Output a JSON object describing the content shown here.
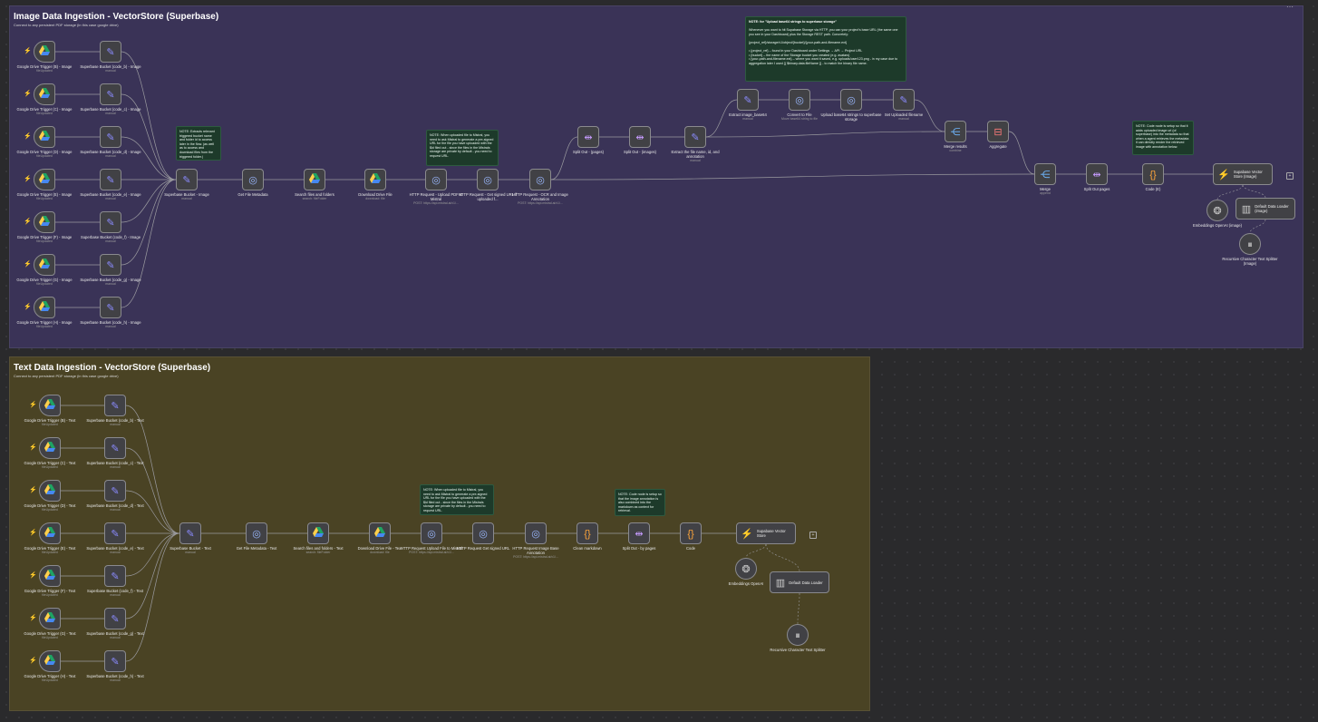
{
  "image_group": {
    "title": "Image Data Ingestion - VectorStore (Superbase)",
    "subtitle": "Connect to any persistent PDF storage (in this case google drive)",
    "triggers": [
      {
        "label": "Google Drive Trigger (B) - Image",
        "sub": "fileUpdated"
      },
      {
        "label": "Google Drive Trigger (C) - Image",
        "sub": "fileUpdated"
      },
      {
        "label": "Google Drive Trigger (D) - Image",
        "sub": "fileUpdated"
      },
      {
        "label": "Google Drive Trigger (E) - Image",
        "sub": "fileUpdated"
      },
      {
        "label": "Google Drive Trigger (F) - Image",
        "sub": "fileUpdated"
      },
      {
        "label": "Google Drive Trigger (G) - Image",
        "sub": "fileUpdated"
      },
      {
        "label": "Google Drive Trigger (H) - Image",
        "sub": "fileUpdated"
      }
    ],
    "buckets": [
      {
        "label": "Superbase Bucket (code_b) - Image",
        "sub": "manual"
      },
      {
        "label": "Superbase Bucket (code_c) - Image",
        "sub": "manual"
      },
      {
        "label": "Superbase Bucket (code_d) - Image",
        "sub": "manual"
      },
      {
        "label": "Superbase Bucket (code_e) - Image",
        "sub": "manual"
      },
      {
        "label": "Superbase Bucket (code_f) - Image",
        "sub": "manual"
      },
      {
        "label": "Superbase Bucket (code_g) - Image",
        "sub": "manual"
      },
      {
        "label": "Superbase Bucket (code_h) - Image",
        "sub": "manual"
      }
    ],
    "pipeline": [
      {
        "label": "Superbase Bucket - Image",
        "sub": "manual"
      },
      {
        "label": "Get File Metadata",
        "sub": ""
      },
      {
        "label": "Search files and folders",
        "sub": "search: fileFolder"
      },
      {
        "label": "Download Drive File",
        "sub": "download: file"
      },
      {
        "label": "HTTP Request - Upload PDF to Mistral",
        "sub": "POST: https://api.mistral.ai/v1/..."
      },
      {
        "label": "HTTP Request - Get signed URL if uploaded f...",
        "sub": ""
      },
      {
        "label": "HTTP Request - OCR and Image Annotation",
        "sub": "POST: https://api.mistral.ai/v1/..."
      }
    ],
    "split_pages": {
      "label": "Split Out - (pages)",
      "sub": ""
    },
    "split_images": {
      "label": "Split Out - (images)",
      "sub": ""
    },
    "extract_meta": {
      "label": "Extract the file name, id, and annotation",
      "sub": "manual"
    },
    "extract_b64": {
      "label": "Extract image_base64",
      "sub": "manual"
    },
    "convert_file": {
      "label": "Convert to File",
      "sub": "Move base64 string to file"
    },
    "upload_b64": {
      "label": "Upload base64 strings to superbase storage",
      "sub": ""
    },
    "set_filename": {
      "label": "Set Uploaded filename",
      "sub": "manual"
    },
    "merge_results": {
      "label": "Merge results",
      "sub": "combine"
    },
    "aggregate": {
      "label": "Aggregate",
      "sub": ""
    },
    "merge": {
      "label": "Merge",
      "sub": "append"
    },
    "split_out_pages": {
      "label": "Split Out pages",
      "sub": ""
    },
    "code": {
      "label": "Code (E)",
      "sub": ""
    },
    "vector": {
      "label": "Supabase Vector Store (Image)",
      "sub": ""
    },
    "embeddings": {
      "label": "Embeddings OpenAI (image)",
      "sub": ""
    },
    "loader": {
      "label": "Default Data Loader (image)",
      "sub": ""
    },
    "splitter": {
      "label": "Recursive Character Text Splitter (Image)",
      "sub": ""
    },
    "edge_labels": {
      "items": "61 items",
      "items2": "61 items",
      "item1": "1 item",
      "items3": "1 item"
    },
    "notes": {
      "bucket": "NOTE: Extracts relevant triggered bucket name and folder id to access later in the flow. (as well as to access and download files from the triggered folder.)",
      "mistral": "NOTE: When uploaded file to Mistral, you need to ask Mistral to generate a pre-signed URL for the file you have uploaded with the $id filed out - since the files in the Mistrals storage are private by default - you need to request URL.",
      "upload_title": "NOTE: for \"Upload base64 strings to superbase storage\"",
      "upload_body1": "Whenever you want to hit Supabase Storage via HTTP, you can your project's base URL (the same one you see in your Dashboard) plus the Storage REST path. Concretely:",
      "upload_body2": "{project_ref}/storage/v1/object/{bucket}/{your-path-and-filename.ext}",
      "upload_body3": "• {project_ref} – found in your Dashboard under Settings → API → Project URL",
      "upload_body4": "• {bucket} – the name of the Storage bucket you created (e.g. avatars)",
      "upload_body5": "• {your-path-and-filename.ext} – where you want it saved, e.g. uploads/user123.png - in my case due to aggregation later I used {{ $binary.data.fileName }} - to match the binary file name.",
      "code": "NOTE: Code node is setup so that it adds uploaded image url (of superbase) into the metadata so that when a agent retrieves the metadata it can directly render the retrieved image with annotation below."
    }
  },
  "text_group": {
    "title": "Text Data Ingestion - VectorStore (Superbase)",
    "subtitle": "Connect to any persistent PDF storage (in this case google drive)",
    "triggers": [
      {
        "label": "Google Drive Trigger (B) - Text",
        "sub": "fileUpdated"
      },
      {
        "label": "Google Drive Trigger (C) - Text",
        "sub": "fileUpdated"
      },
      {
        "label": "Google Drive Trigger (D) - Text",
        "sub": "fileUpdated"
      },
      {
        "label": "Google Drive Trigger (E) - Text",
        "sub": "fileUpdated"
      },
      {
        "label": "Google Drive Trigger (F) - Text",
        "sub": "fileUpdated"
      },
      {
        "label": "Google Drive Trigger (G) - Text",
        "sub": "fileUpdated"
      },
      {
        "label": "Google Drive Trigger (H) - Text",
        "sub": "fileUpdated"
      }
    ],
    "buckets": [
      {
        "label": "Superbase Bucket (code_b) - Text",
        "sub": "manual"
      },
      {
        "label": "Superbase Bucket (code_c) - Text",
        "sub": "manual"
      },
      {
        "label": "Superbase Bucket (code_d) - Text",
        "sub": "manual"
      },
      {
        "label": "Superbase Bucket (code_e) - Text",
        "sub": "manual"
      },
      {
        "label": "Superbase Bucket (code_f) - Text",
        "sub": "manual"
      },
      {
        "label": "Superbase Bucket (code_g) - Text",
        "sub": "manual"
      },
      {
        "label": "Superbase Bucket (code_h) - Text",
        "sub": "manual"
      }
    ],
    "pipeline": [
      {
        "label": "Superbase Bucket - Text",
        "sub": "manual"
      },
      {
        "label": "Get File Metadata - Text",
        "sub": ""
      },
      {
        "label": "Search files and folders - Text",
        "sub": "search: fileFolder"
      },
      {
        "label": "Download Drive File - Text",
        "sub": "download: file"
      },
      {
        "label": "HTTP Request Upload File to Mistral",
        "sub": "POST: https://api.mistral.ai/v1/..."
      },
      {
        "label": "HTTP Request Get signed URL",
        "sub": ""
      },
      {
        "label": "HTTP Request Image Base Annotation",
        "sub": "POST: https://api.mistral.ai/v1/..."
      },
      {
        "label": "Clean markdown",
        "sub": ""
      },
      {
        "label": "Split Out - by pages",
        "sub": ""
      },
      {
        "label": "Code",
        "sub": ""
      }
    ],
    "vector": {
      "label": "Supabase Vector Store",
      "sub": ""
    },
    "embeddings": {
      "label": "Embeddings OpenAI",
      "sub": ""
    },
    "loader": {
      "label": "Default Data Loader",
      "sub": ""
    },
    "splitter": {
      "label": "Recursive Character Text Splitter",
      "sub": ""
    },
    "notes": {
      "mistral": "NOTE: When uploaded file to Mistral, you need to ask Mistral to generate a pre-signed URL for the file you have uploaded with the $id filed out - since the files in the Mistrals storage are private by default - you need to request URL.",
      "code": "NOTE: Code node is setup so that the image annotation is also combined into the markdown as context for retrieval."
    }
  },
  "icons": {
    "trigger": "lightning-icon",
    "drive": "google-drive-icon",
    "edit": "pencil-icon",
    "http": "globe-icon",
    "split": "split-icon",
    "merge": "merge-icon",
    "code": "braces-icon",
    "vector": "supabase-icon"
  },
  "colors": {
    "image_group": "#3a3357",
    "text_group": "#4a4324",
    "note": "#1d3a2a",
    "trigger": "#ff5a4b"
  }
}
